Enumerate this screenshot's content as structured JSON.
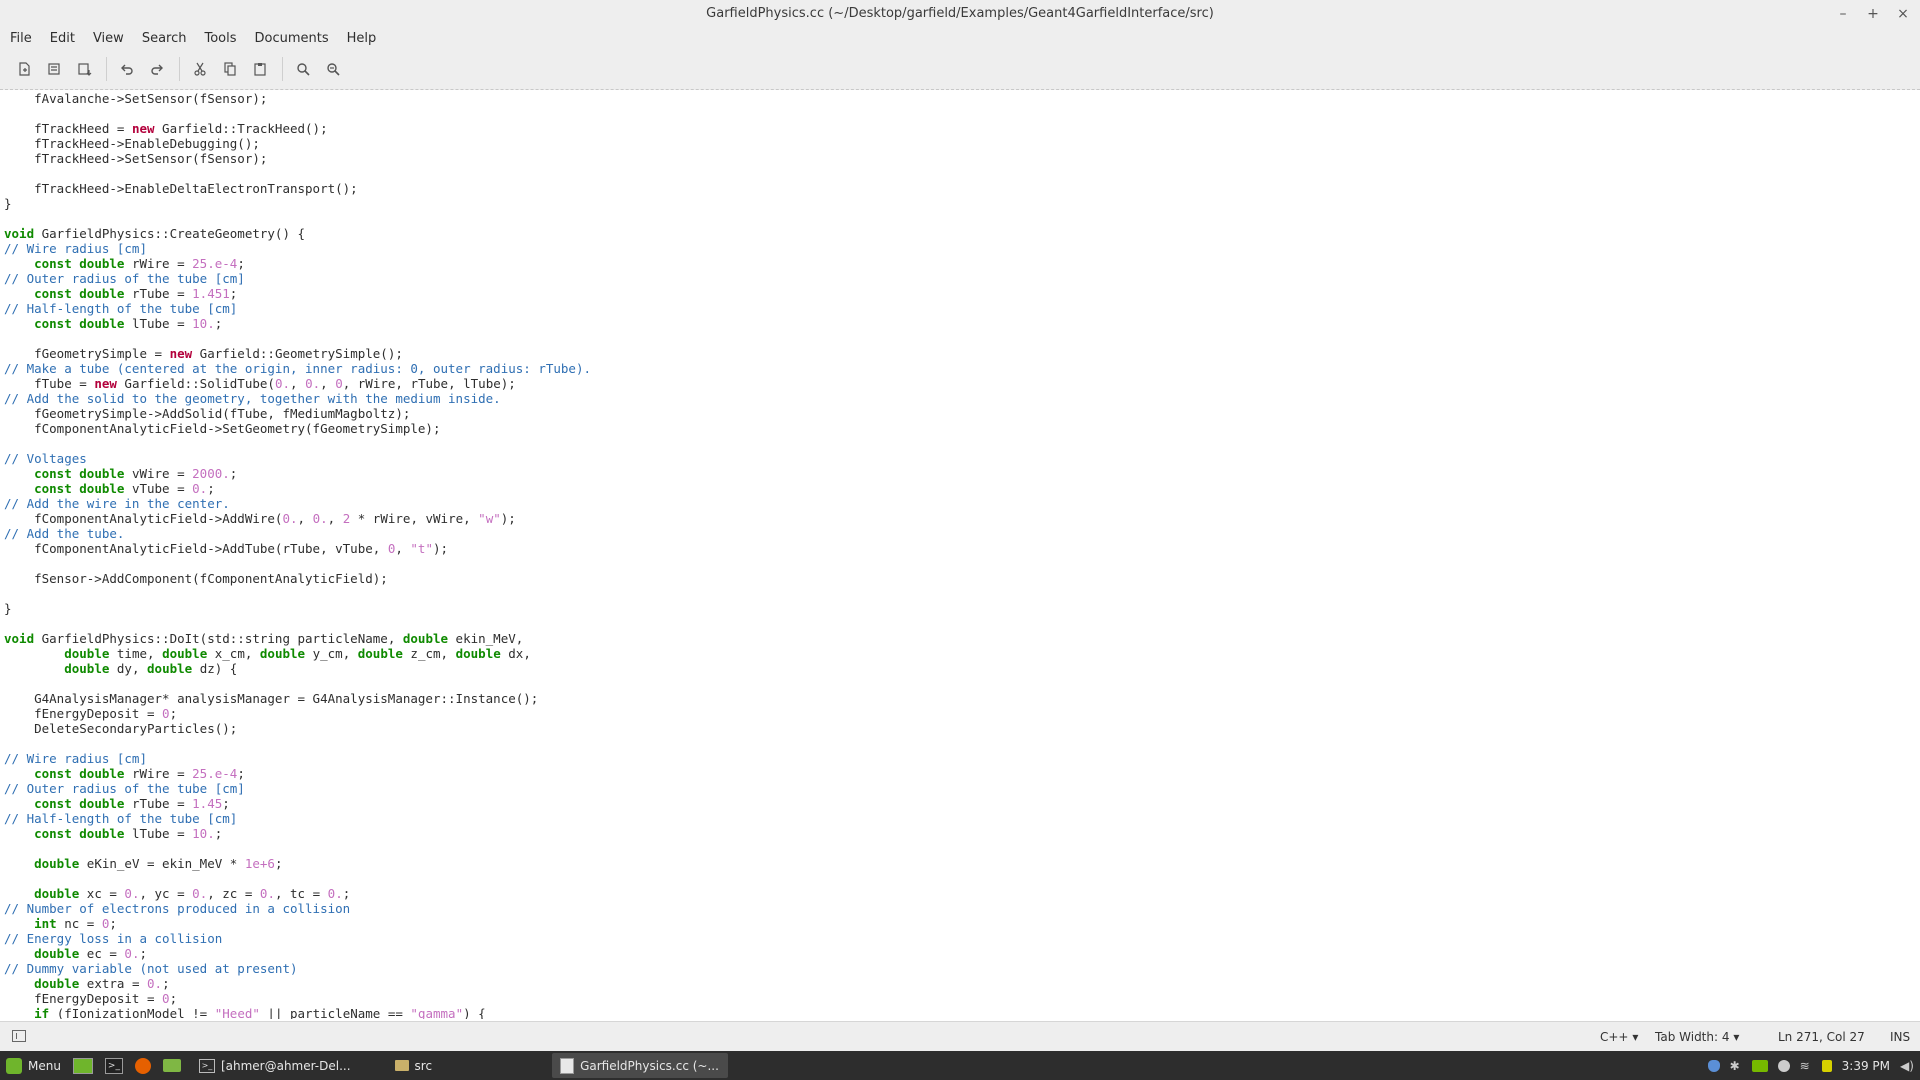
{
  "window": {
    "title": "GarfieldPhysics.cc (~/Desktop/garfield/Examples/Geant4GarfieldInterface/src)",
    "controls": [
      "–",
      "+",
      "×"
    ]
  },
  "menubar": [
    "File",
    "Edit",
    "View",
    "Search",
    "Tools",
    "Documents",
    "Help"
  ],
  "toolbar_icons": [
    "new-document-icon",
    "open-icon",
    "save-icon",
    "undo-icon",
    "redo-icon",
    "cut-icon",
    "copy-icon",
    "paste-icon",
    "find-icon",
    "find-replace-icon"
  ],
  "code_lines": [
    [
      [
        "",
        "    fAvalanche->SetSensor(fSensor);"
      ]
    ],
    [],
    [
      [
        "",
        "    fTrackHeed = "
      ],
      [
        "new",
        "new"
      ],
      [
        "",
        " Garfield::TrackHeed();"
      ]
    ],
    [
      [
        "",
        "    fTrackHeed->EnableDebugging();"
      ]
    ],
    [
      [
        "",
        "    fTrackHeed->SetSensor(fSensor);"
      ]
    ],
    [],
    [
      [
        "",
        "    fTrackHeed->EnableDeltaElectronTransport();"
      ]
    ],
    [
      [
        "",
        "}"
      ]
    ],
    [],
    [
      [
        "kw",
        "void"
      ],
      [
        "",
        " GarfieldPhysics::CreateGeometry() {"
      ]
    ],
    [
      [
        "cm",
        "// Wire radius [cm]"
      ]
    ],
    [
      [
        "",
        "    "
      ],
      [
        "kw",
        "const double"
      ],
      [
        "",
        " rWire = "
      ],
      [
        "num",
        "25.e-4"
      ],
      [
        "",
        ";"
      ]
    ],
    [
      [
        "cm",
        "// Outer radius of the tube [cm]"
      ]
    ],
    [
      [
        "",
        "    "
      ],
      [
        "kw",
        "const double"
      ],
      [
        "",
        " rTube = "
      ],
      [
        "num",
        "1.451"
      ],
      [
        "",
        ";"
      ]
    ],
    [
      [
        "cm",
        "// Half-length of the tube [cm]"
      ]
    ],
    [
      [
        "",
        "    "
      ],
      [
        "kw",
        "const double"
      ],
      [
        "",
        " lTube = "
      ],
      [
        "num",
        "10."
      ],
      [
        "",
        ";"
      ]
    ],
    [],
    [
      [
        "",
        "    fGeometrySimple = "
      ],
      [
        "new",
        "new"
      ],
      [
        "",
        " Garfield::GeometrySimple();"
      ]
    ],
    [
      [
        "cm",
        "// Make a tube (centered at the origin, inner radius: 0, outer radius: rTube)."
      ]
    ],
    [
      [
        "",
        "    fTube = "
      ],
      [
        "new",
        "new"
      ],
      [
        "",
        " Garfield::SolidTube("
      ],
      [
        "num",
        "0."
      ],
      [
        "",
        ", "
      ],
      [
        "num",
        "0."
      ],
      [
        "",
        ", "
      ],
      [
        "num",
        "0"
      ],
      [
        "",
        ", rWire, rTube, lTube);"
      ]
    ],
    [
      [
        "cm",
        "// Add the solid to the geometry, together with the medium inside."
      ]
    ],
    [
      [
        "",
        "    fGeometrySimple->AddSolid(fTube, fMediumMagboltz);"
      ]
    ],
    [
      [
        "",
        "    fComponentAnalyticField->SetGeometry(fGeometrySimple);"
      ]
    ],
    [],
    [
      [
        "cm",
        "// Voltages"
      ]
    ],
    [
      [
        "",
        "    "
      ],
      [
        "kw",
        "const double"
      ],
      [
        "",
        " vWire = "
      ],
      [
        "num",
        "2000."
      ],
      [
        "",
        ";"
      ]
    ],
    [
      [
        "",
        "    "
      ],
      [
        "kw",
        "const double"
      ],
      [
        "",
        " vTube = "
      ],
      [
        "num",
        "0."
      ],
      [
        "",
        ";"
      ]
    ],
    [
      [
        "cm",
        "// Add the wire in the center."
      ]
    ],
    [
      [
        "",
        "    fComponentAnalyticField->AddWire("
      ],
      [
        "num",
        "0."
      ],
      [
        "",
        ", "
      ],
      [
        "num",
        "0."
      ],
      [
        "",
        ", "
      ],
      [
        "num",
        "2"
      ],
      [
        "",
        " * rWire, vWire, "
      ],
      [
        "str",
        "\"w\""
      ],
      [
        "",
        ");"
      ]
    ],
    [
      [
        "cm",
        "// Add the tube."
      ]
    ],
    [
      [
        "",
        "    fComponentAnalyticField->AddTube(rTube, vTube, "
      ],
      [
        "num",
        "0"
      ],
      [
        "",
        ", "
      ],
      [
        "str",
        "\"t\""
      ],
      [
        "",
        ");"
      ]
    ],
    [],
    [
      [
        "",
        "    fSensor->AddComponent(fComponentAnalyticField);"
      ]
    ],
    [],
    [
      [
        "",
        "}"
      ]
    ],
    [],
    [
      [
        "kw",
        "void"
      ],
      [
        "",
        " GarfieldPhysics::DoIt(std::string particleName, "
      ],
      [
        "kw",
        "double"
      ],
      [
        "",
        " ekin_MeV,"
      ]
    ],
    [
      [
        "",
        "        "
      ],
      [
        "kw",
        "double"
      ],
      [
        "",
        " time, "
      ],
      [
        "kw",
        "double"
      ],
      [
        "",
        " x_cm, "
      ],
      [
        "kw",
        "double"
      ],
      [
        "",
        " y_cm, "
      ],
      [
        "kw",
        "double"
      ],
      [
        "",
        " z_cm, "
      ],
      [
        "kw",
        "double"
      ],
      [
        "",
        " dx,"
      ]
    ],
    [
      [
        "",
        "        "
      ],
      [
        "kw",
        "double"
      ],
      [
        "",
        " dy, "
      ],
      [
        "kw",
        "double"
      ],
      [
        "",
        " dz) {"
      ]
    ],
    [],
    [
      [
        "",
        "    G4AnalysisManager* analysisManager = G4AnalysisManager::Instance();"
      ]
    ],
    [
      [
        "",
        "    fEnergyDeposit = "
      ],
      [
        "num",
        "0"
      ],
      [
        "",
        ";"
      ]
    ],
    [
      [
        "",
        "    DeleteSecondaryParticles();"
      ]
    ],
    [],
    [
      [
        "cm",
        "// Wire radius [cm]"
      ]
    ],
    [
      [
        "",
        "    "
      ],
      [
        "kw",
        "const double"
      ],
      [
        "",
        " rWire = "
      ],
      [
        "num",
        "25.e-4"
      ],
      [
        "",
        ";"
      ]
    ],
    [
      [
        "cm",
        "// Outer radius of the tube [cm]"
      ]
    ],
    [
      [
        "",
        "    "
      ],
      [
        "kw",
        "const double"
      ],
      [
        "",
        " rTube = "
      ],
      [
        "num",
        "1.45"
      ],
      [
        "",
        ";"
      ]
    ],
    [
      [
        "cm",
        "// Half-length of the tube [cm]"
      ]
    ],
    [
      [
        "",
        "    "
      ],
      [
        "kw",
        "const double"
      ],
      [
        "",
        " lTube = "
      ],
      [
        "num",
        "10."
      ],
      [
        "",
        ";"
      ]
    ],
    [],
    [
      [
        "",
        "    "
      ],
      [
        "kw",
        "double"
      ],
      [
        "",
        " eKin_eV = ekin_MeV * "
      ],
      [
        "num",
        "1e+6"
      ],
      [
        "",
        ";"
      ]
    ],
    [],
    [
      [
        "",
        "    "
      ],
      [
        "kw",
        "double"
      ],
      [
        "",
        " xc = "
      ],
      [
        "num",
        "0."
      ],
      [
        "",
        ", yc = "
      ],
      [
        "num",
        "0."
      ],
      [
        "",
        ", zc = "
      ],
      [
        "num",
        "0."
      ],
      [
        "",
        ", tc = "
      ],
      [
        "num",
        "0."
      ],
      [
        "",
        ";"
      ]
    ],
    [
      [
        "cm",
        "// Number of electrons produced in a collision"
      ]
    ],
    [
      [
        "",
        "    "
      ],
      [
        "kw",
        "int"
      ],
      [
        "",
        " nc = "
      ],
      [
        "num",
        "0"
      ],
      [
        "",
        ";"
      ]
    ],
    [
      [
        "cm",
        "// Energy loss in a collision"
      ]
    ],
    [
      [
        "",
        "    "
      ],
      [
        "kw",
        "double"
      ],
      [
        "",
        " ec = "
      ],
      [
        "num",
        "0."
      ],
      [
        "",
        ";"
      ]
    ],
    [
      [
        "cm",
        "// Dummy variable (not used at present)"
      ]
    ],
    [
      [
        "",
        "    "
      ],
      [
        "kw",
        "double"
      ],
      [
        "",
        " extra = "
      ],
      [
        "num",
        "0."
      ],
      [
        "",
        ";"
      ]
    ],
    [
      [
        "",
        "    fEnergyDeposit = "
      ],
      [
        "num",
        "0"
      ],
      [
        "",
        ";"
      ]
    ],
    [
      [
        "",
        "    "
      ],
      [
        "kw",
        "if"
      ],
      [
        "",
        " (fIonizationModel != "
      ],
      [
        "str",
        "\"Heed\""
      ],
      [
        "",
        " || particleName == "
      ],
      [
        "str",
        "\"gamma\""
      ],
      [
        "",
        ") {"
      ]
    ]
  ],
  "statusbar": {
    "language": "C++",
    "tab_width": "Tab Width: 4",
    "position": "Ln 271, Col 27",
    "mode": "INS"
  },
  "taskbar": {
    "menu_label": "Menu",
    "windows": [
      {
        "label": "[ahmer@ahmer-Del...",
        "icon": "terminal-icon",
        "active": false
      },
      {
        "label": "src",
        "icon": "folder-icon",
        "active": false
      },
      {
        "label": "GarfieldPhysics.cc (~...",
        "icon": "text-editor-icon",
        "active": true
      }
    ],
    "clock": "3:39 PM"
  }
}
